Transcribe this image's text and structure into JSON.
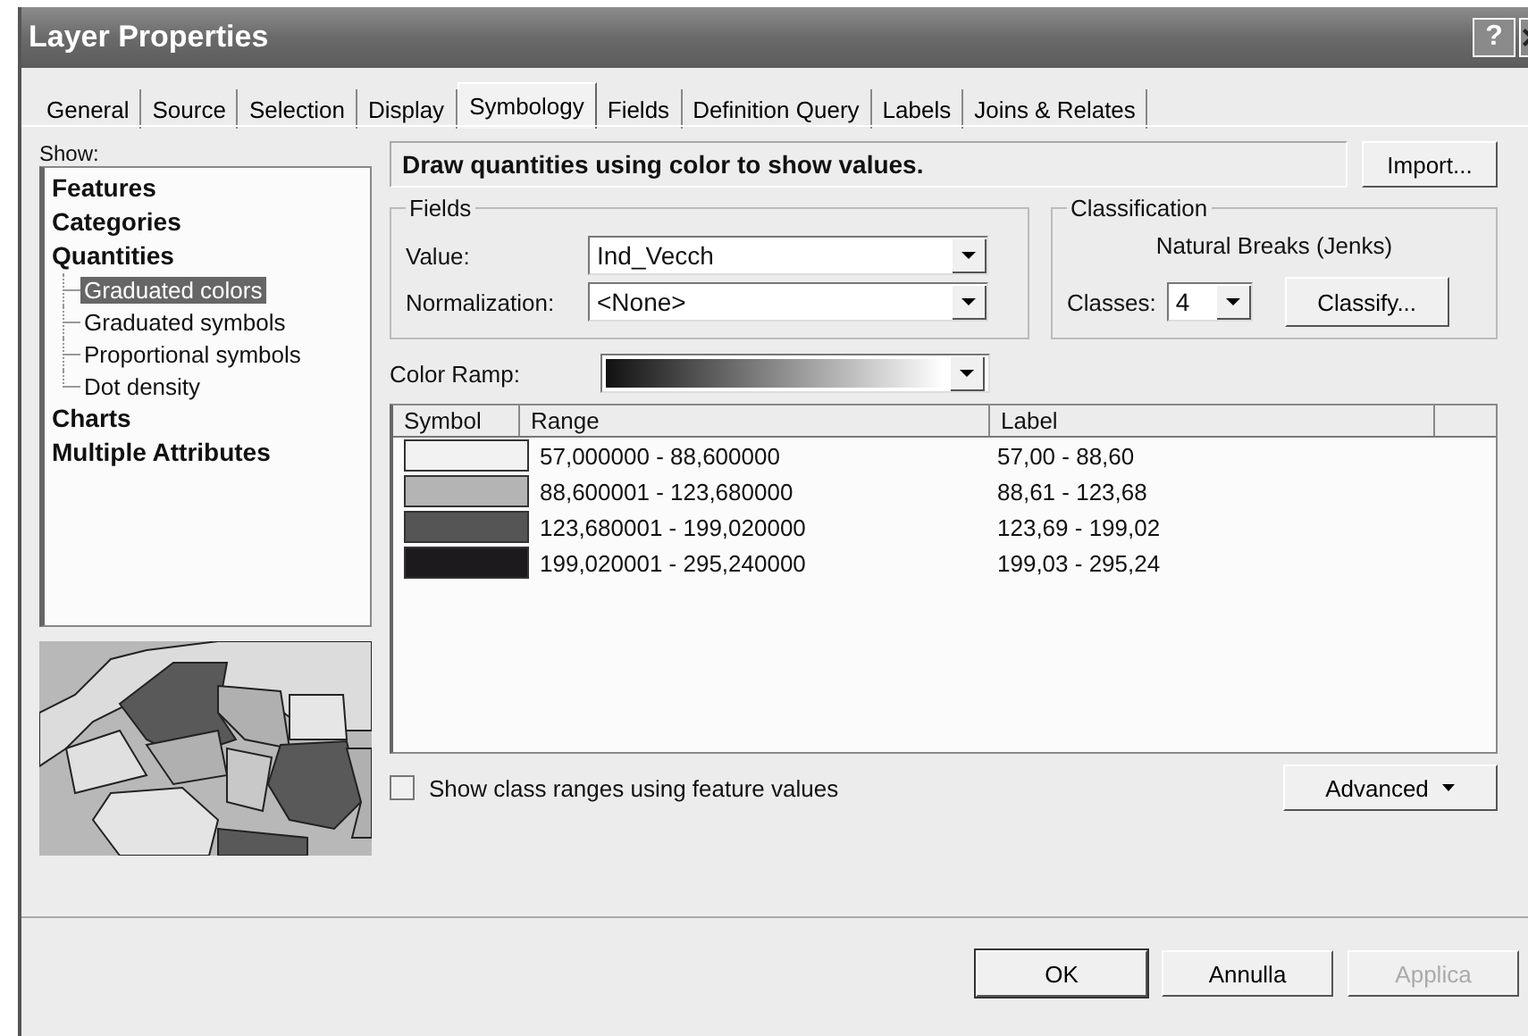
{
  "window": {
    "title": "Layer Properties",
    "help_button": "?"
  },
  "tabs": [
    {
      "label": "General",
      "selected": false
    },
    {
      "label": "Source",
      "selected": false
    },
    {
      "label": "Selection",
      "selected": false
    },
    {
      "label": "Display",
      "selected": false
    },
    {
      "label": "Symbology",
      "selected": true
    },
    {
      "label": "Fields",
      "selected": false
    },
    {
      "label": "Definition Query",
      "selected": false
    },
    {
      "label": "Labels",
      "selected": false
    },
    {
      "label": "Joins & Relates",
      "selected": false
    }
  ],
  "show": {
    "label": "Show:",
    "items": [
      {
        "label": "Features",
        "selected": false
      },
      {
        "label": "Categories",
        "selected": false
      },
      {
        "label": "Quantities",
        "selected": false,
        "children": [
          {
            "label": "Graduated colors",
            "selected": true
          },
          {
            "label": "Graduated symbols",
            "selected": false
          },
          {
            "label": "Proportional symbols",
            "selected": false
          },
          {
            "label": "Dot density",
            "selected": false
          }
        ]
      },
      {
        "label": "Charts",
        "selected": false
      },
      {
        "label": "Multiple Attributes",
        "selected": false
      }
    ]
  },
  "description": "Draw quantities using color to show values.",
  "import_button": "Import...",
  "fields": {
    "title": "Fields",
    "value_label": "Value:",
    "value": "Ind_Vecch",
    "normalization_label": "Normalization:",
    "normalization": "<None>"
  },
  "classification": {
    "title": "Classification",
    "method": "Natural Breaks (Jenks)",
    "classes_label": "Classes:",
    "classes": "4",
    "classify_button": "Classify..."
  },
  "color_ramp": {
    "label": "Color Ramp:"
  },
  "table": {
    "columns": [
      "Symbol",
      "Range",
      "Label"
    ],
    "rows": [
      {
        "color": "#f2f2f2",
        "range": "57,000000 - 88,600000",
        "label": "57,00 - 88,60"
      },
      {
        "color": "#b4b4b4",
        "range": "88,600001 - 123,680000",
        "label": "88,61 - 123,68"
      },
      {
        "color": "#555555",
        "range": "123,680001 - 199,020000",
        "label": "123,69 - 199,02"
      },
      {
        "color": "#1c1a1c",
        "range": "199,020001 - 295,240000",
        "label": "199,03 - 295,24"
      }
    ]
  },
  "show_class_ranges": {
    "label": "Show class ranges using feature values",
    "checked": false
  },
  "advanced_button": "Advanced",
  "buttons": [
    {
      "label": "OK",
      "disabled": false
    },
    {
      "label": "Annulla",
      "disabled": false
    },
    {
      "label": "Applica",
      "disabled": true
    }
  ]
}
